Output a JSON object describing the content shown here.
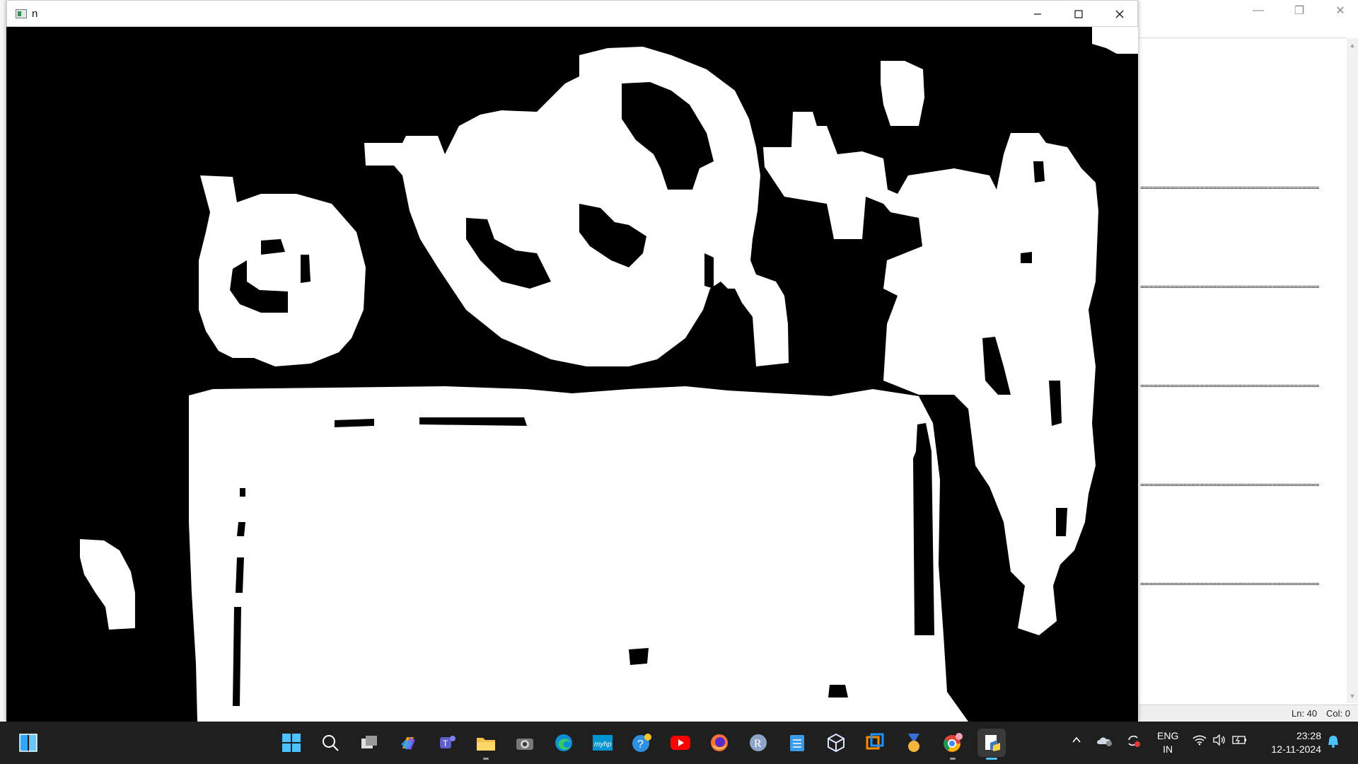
{
  "window": {
    "title": "n"
  },
  "background_window": {
    "separator_text": "==========================================",
    "status": {
      "line": "Ln: 40",
      "column": "Col: 0"
    }
  },
  "taskbar": {
    "apps": [
      {
        "name": "Start",
        "icon": "windows-start-icon"
      },
      {
        "name": "Search",
        "icon": "search-icon"
      },
      {
        "name": "Task View",
        "icon": "task-view-icon"
      },
      {
        "name": "Copilot",
        "icon": "copilot-icon"
      },
      {
        "name": "Teams",
        "icon": "teams-icon"
      },
      {
        "name": "File Explorer",
        "icon": "folder-icon"
      },
      {
        "name": "Camera",
        "icon": "camera-icon"
      },
      {
        "name": "Edge",
        "icon": "edge-icon"
      },
      {
        "name": "myHP",
        "icon": "myhp-icon"
      },
      {
        "name": "Get Help",
        "icon": "help-icon"
      },
      {
        "name": "YouTube",
        "icon": "youtube-icon"
      },
      {
        "name": "Firefox",
        "icon": "firefox-icon"
      },
      {
        "name": "R",
        "icon": "r-icon"
      },
      {
        "name": "Notepad",
        "icon": "notepad-icon"
      },
      {
        "name": "VirtualBox",
        "icon": "virtualbox-icon"
      },
      {
        "name": "VMware",
        "icon": "vmware-icon"
      },
      {
        "name": "Medal",
        "icon": "medal-icon"
      },
      {
        "name": "Chrome",
        "icon": "chrome-icon"
      },
      {
        "name": "Python IDLE",
        "icon": "idle-icon"
      }
    ],
    "tray": {
      "language_top": "ENG",
      "language_bottom": "IN",
      "time": "23:28",
      "date": "12-11-2024"
    }
  }
}
